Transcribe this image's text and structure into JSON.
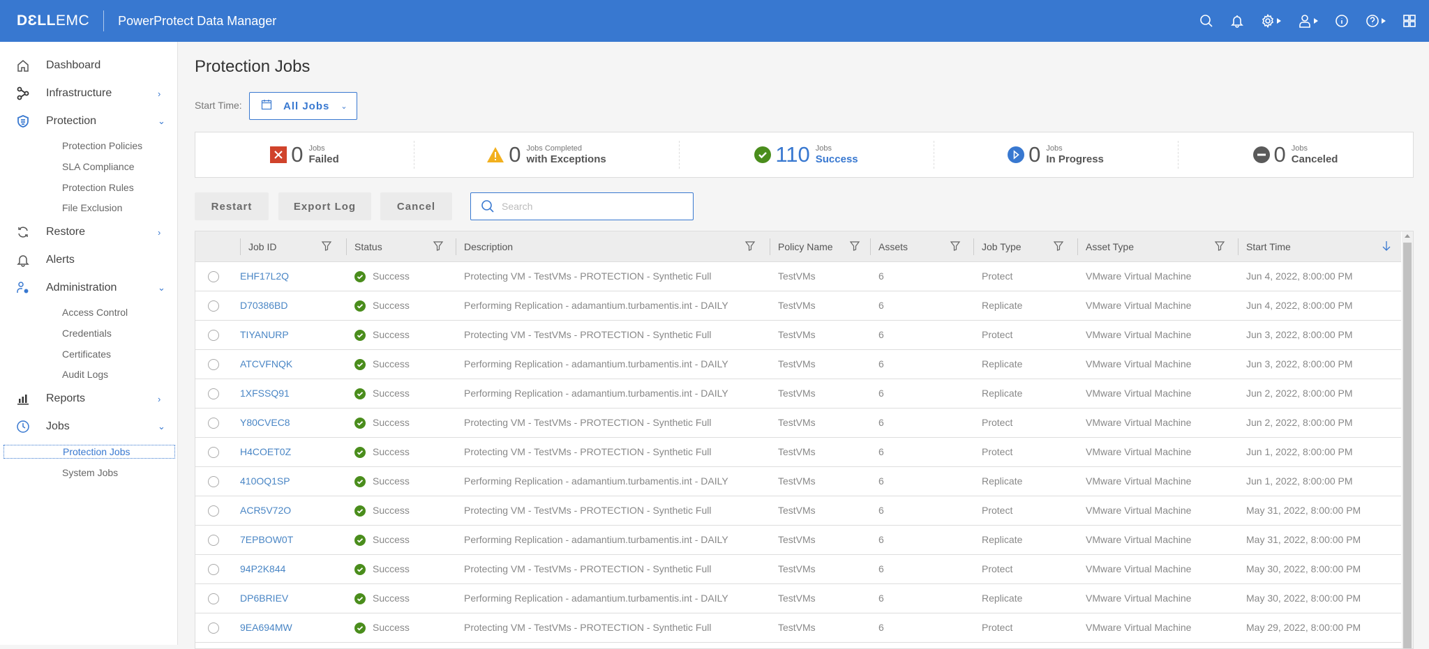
{
  "header": {
    "logo_dell": "DƐLL",
    "logo_emc": "EMC",
    "app_title": "PowerProtect Data Manager",
    "icons": [
      "search-icon",
      "bell-icon",
      "gear-icon",
      "user-icon",
      "info-icon",
      "help-icon",
      "apps-grid-icon"
    ]
  },
  "sidebar": {
    "items": [
      {
        "label": "Dashboard",
        "icon": "home-icon"
      },
      {
        "label": "Infrastructure",
        "icon": "infrastructure-icon",
        "chevron": "›"
      },
      {
        "label": "Protection",
        "icon": "shield-icon",
        "chevron": "⌄"
      },
      {
        "label": "Restore",
        "icon": "restore-icon",
        "chevron": "›"
      },
      {
        "label": "Alerts",
        "icon": "bell-icon"
      },
      {
        "label": "Administration",
        "icon": "admin-icon",
        "chevron": "⌄"
      },
      {
        "label": "Reports",
        "icon": "reports-icon",
        "chevron": "›"
      },
      {
        "label": "Jobs",
        "icon": "clock-icon",
        "chevron": "⌄"
      }
    ],
    "protection_sub": [
      "Protection Policies",
      "SLA Compliance",
      "Protection Rules",
      "File Exclusion"
    ],
    "administration_sub": [
      "Access Control",
      "Credentials",
      "Certificates",
      "Audit Logs"
    ],
    "jobs_sub": [
      "Protection Jobs",
      "System Jobs"
    ],
    "active": "Protection Jobs"
  },
  "main": {
    "title": "Protection Jobs",
    "start_time_label": "Start Time:",
    "start_time_value": "All Jobs",
    "summary": [
      {
        "count": "0",
        "small": "Jobs",
        "big": "Failed",
        "icon": "failed-icon",
        "color": "#d0432b"
      },
      {
        "count": "0",
        "small": "Jobs Completed",
        "big": "with Exceptions",
        "icon": "warning-icon",
        "color": "#f2b01e"
      },
      {
        "count": "110",
        "small": "Jobs",
        "big": "Success",
        "icon": "success-icon",
        "color": "#4a8d1c"
      },
      {
        "count": "0",
        "small": "Jobs",
        "big": "In Progress",
        "icon": "in-progress-icon",
        "color": "#3878d0"
      },
      {
        "count": "0",
        "small": "Jobs",
        "big": "Canceled",
        "icon": "canceled-icon",
        "color": "#5a5a5a"
      }
    ],
    "buttons": {
      "restart": "Restart",
      "export_log": "Export Log",
      "cancel": "Cancel"
    },
    "search_placeholder": "Search",
    "columns": [
      "Job ID",
      "Status",
      "Description",
      "Policy Name",
      "Assets",
      "Job Type",
      "Asset Type",
      "Start Time"
    ],
    "rows": [
      {
        "job_id": "EHF17L2Q",
        "status": "Success",
        "description": "Protecting VM - TestVMs - PROTECTION - Synthetic Full",
        "policy": "TestVMs",
        "assets": "6",
        "job_type": "Protect",
        "asset_type": "VMware Virtual Machine",
        "start_time": "Jun 4, 2022, 8:00:00 PM"
      },
      {
        "job_id": "D70386BD",
        "status": "Success",
        "description": "Performing Replication - adamantium.turbamentis.int - DAILY",
        "policy": "TestVMs",
        "assets": "6",
        "job_type": "Replicate",
        "asset_type": "VMware Virtual Machine",
        "start_time": "Jun 4, 2022, 8:00:00 PM"
      },
      {
        "job_id": "TIYANURP",
        "status": "Success",
        "description": "Protecting VM - TestVMs - PROTECTION - Synthetic Full",
        "policy": "TestVMs",
        "assets": "6",
        "job_type": "Protect",
        "asset_type": "VMware Virtual Machine",
        "start_time": "Jun 3, 2022, 8:00:00 PM"
      },
      {
        "job_id": "ATCVFNQK",
        "status": "Success",
        "description": "Performing Replication - adamantium.turbamentis.int - DAILY",
        "policy": "TestVMs",
        "assets": "6",
        "job_type": "Replicate",
        "asset_type": "VMware Virtual Machine",
        "start_time": "Jun 3, 2022, 8:00:00 PM"
      },
      {
        "job_id": "1XFSSQ91",
        "status": "Success",
        "description": "Performing Replication - adamantium.turbamentis.int - DAILY",
        "policy": "TestVMs",
        "assets": "6",
        "job_type": "Replicate",
        "asset_type": "VMware Virtual Machine",
        "start_time": "Jun 2, 2022, 8:00:00 PM"
      },
      {
        "job_id": "Y80CVEC8",
        "status": "Success",
        "description": "Protecting VM - TestVMs - PROTECTION - Synthetic Full",
        "policy": "TestVMs",
        "assets": "6",
        "job_type": "Protect",
        "asset_type": "VMware Virtual Machine",
        "start_time": "Jun 2, 2022, 8:00:00 PM"
      },
      {
        "job_id": "H4COET0Z",
        "status": "Success",
        "description": "Protecting VM - TestVMs - PROTECTION - Synthetic Full",
        "policy": "TestVMs",
        "assets": "6",
        "job_type": "Protect",
        "asset_type": "VMware Virtual Machine",
        "start_time": "Jun 1, 2022, 8:00:00 PM"
      },
      {
        "job_id": "410OQ1SP",
        "status": "Success",
        "description": "Performing Replication - adamantium.turbamentis.int - DAILY",
        "policy": "TestVMs",
        "assets": "6",
        "job_type": "Replicate",
        "asset_type": "VMware Virtual Machine",
        "start_time": "Jun 1, 2022, 8:00:00 PM"
      },
      {
        "job_id": "ACR5V72O",
        "status": "Success",
        "description": "Protecting VM - TestVMs - PROTECTION - Synthetic Full",
        "policy": "TestVMs",
        "assets": "6",
        "job_type": "Protect",
        "asset_type": "VMware Virtual Machine",
        "start_time": "May 31, 2022, 8:00:00 PM"
      },
      {
        "job_id": "7EPBOW0T",
        "status": "Success",
        "description": "Performing Replication - adamantium.turbamentis.int - DAILY",
        "policy": "TestVMs",
        "assets": "6",
        "job_type": "Replicate",
        "asset_type": "VMware Virtual Machine",
        "start_time": "May 31, 2022, 8:00:00 PM"
      },
      {
        "job_id": "94P2K844",
        "status": "Success",
        "description": "Protecting VM - TestVMs - PROTECTION - Synthetic Full",
        "policy": "TestVMs",
        "assets": "6",
        "job_type": "Protect",
        "asset_type": "VMware Virtual Machine",
        "start_time": "May 30, 2022, 8:00:00 PM"
      },
      {
        "job_id": "DP6BRIEV",
        "status": "Success",
        "description": "Performing Replication - adamantium.turbamentis.int - DAILY",
        "policy": "TestVMs",
        "assets": "6",
        "job_type": "Replicate",
        "asset_type": "VMware Virtual Machine",
        "start_time": "May 30, 2022, 8:00:00 PM"
      },
      {
        "job_id": "9EA694MW",
        "status": "Success",
        "description": "Protecting VM - TestVMs - PROTECTION - Synthetic Full",
        "policy": "TestVMs",
        "assets": "6",
        "job_type": "Protect",
        "asset_type": "VMware Virtual Machine",
        "start_time": "May 29, 2022, 8:00:00 PM"
      }
    ],
    "sort_icon": "sort-descending-icon"
  },
  "colors": {
    "brand": "#3878d0",
    "success": "#4a8d1c",
    "link": "#4a86c5"
  }
}
